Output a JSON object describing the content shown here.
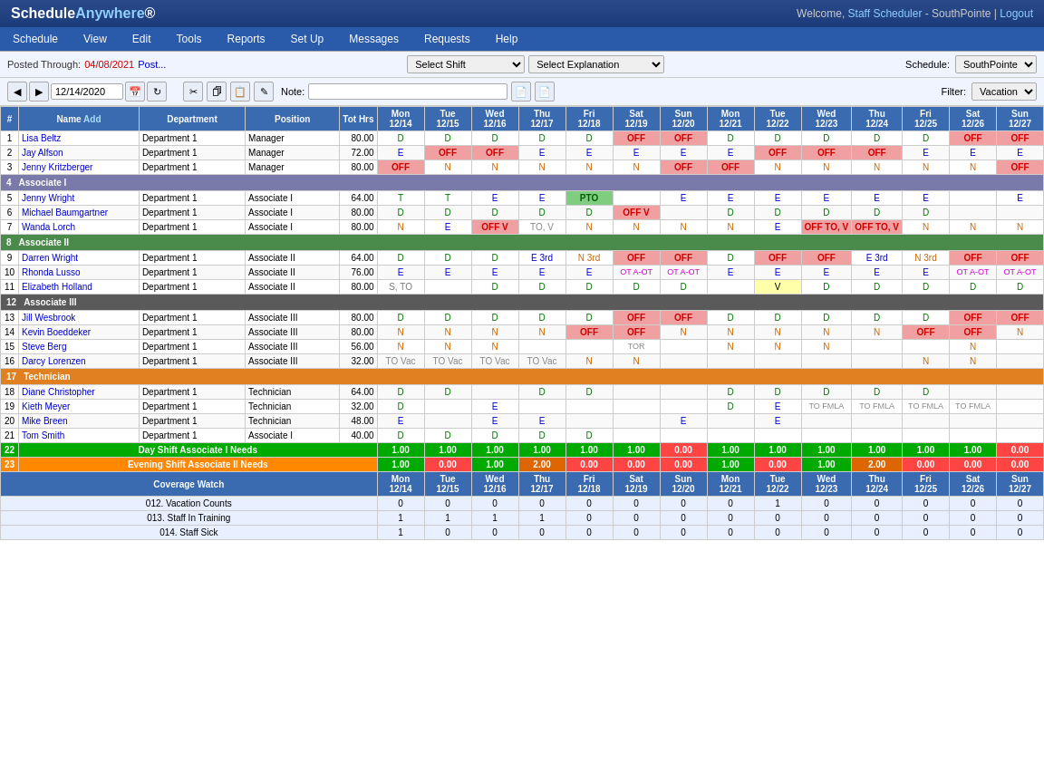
{
  "app": {
    "title": "ScheduleAnywhere",
    "welcome": "Welcome,",
    "user": "Staff Scheduler",
    "org": "SouthPointe",
    "logout": "Logout"
  },
  "nav": {
    "items": [
      "Schedule",
      "View",
      "Edit",
      "Tools",
      "Reports",
      "Set Up",
      "Messages",
      "Requests",
      "Help"
    ]
  },
  "toolbar": {
    "posted_label": "Posted Through:",
    "posted_date": "04/08/2021",
    "post_link": "Post...",
    "date_value": "12/14/2020",
    "shift_placeholder": "Select Shift",
    "explanation_placeholder": "Select Explanation",
    "note_label": "Note:",
    "schedule_label": "Schedule:",
    "schedule_value": "SouthPointe",
    "filter_label": "Filter:",
    "filter_value": "Vacation"
  },
  "table": {
    "headers": {
      "num": "#",
      "name": "Name",
      "add": "Add",
      "department": "Department",
      "position": "Position",
      "tot_hrs": "Tot Hrs",
      "days": [
        {
          "day": "Mon",
          "date": "12/14"
        },
        {
          "day": "Tue",
          "date": "12/15"
        },
        {
          "day": "Wed",
          "date": "12/16"
        },
        {
          "day": "Thu",
          "date": "12/17"
        },
        {
          "day": "Fri",
          "date": "12/18"
        },
        {
          "day": "Sat",
          "date": "12/19"
        },
        {
          "day": "Sun",
          "date": "12/20"
        },
        {
          "day": "Mon",
          "date": "12/21"
        },
        {
          "day": "Tue",
          "date": "12/22"
        },
        {
          "day": "Wed",
          "date": "12/23"
        },
        {
          "day": "Thu",
          "date": "12/24"
        },
        {
          "day": "Fri",
          "date": "12/25"
        },
        {
          "day": "Sat",
          "date": "12/26"
        },
        {
          "day": "Sun",
          "date": "12/27"
        }
      ]
    },
    "rows": [
      {
        "num": 1,
        "name": "Lisa Beltz",
        "dept": "Department 1",
        "pos": "Manager",
        "hrs": "80.00",
        "days": [
          "D",
          "D",
          "D",
          "D",
          "D",
          "OFF",
          "OFF",
          "D",
          "D",
          "D",
          "D",
          "D",
          "OFF",
          "OFF"
        ],
        "types": [
          "d",
          "d",
          "d",
          "d",
          "d",
          "off",
          "off",
          "d",
          "d",
          "d",
          "d",
          "d",
          "off",
          "off"
        ]
      },
      {
        "num": 2,
        "name": "Jay Alfson",
        "dept": "Department 1",
        "pos": "Manager",
        "hrs": "72.00",
        "days": [
          "E",
          "OFF",
          "OFF",
          "E",
          "E",
          "E",
          "E",
          "E",
          "OFF",
          "OFF",
          "OFF",
          "E",
          "E",
          "E"
        ],
        "types": [
          "e",
          "off",
          "off",
          "e",
          "e",
          "e",
          "e",
          "e",
          "off",
          "off",
          "off",
          "e",
          "e",
          "e"
        ]
      },
      {
        "num": 3,
        "name": "Jenny Kritzberger",
        "dept": "Department 1",
        "pos": "Manager",
        "hrs": "80.00",
        "days": [
          "OFF",
          "N",
          "N",
          "N",
          "N",
          "N",
          "OFF",
          "OFF",
          "N",
          "N",
          "N",
          "N",
          "N",
          "OFF"
        ],
        "types": [
          "off",
          "n",
          "n",
          "n",
          "n",
          "n",
          "off",
          "off",
          "n",
          "n",
          "n",
          "n",
          "n",
          "off"
        ]
      },
      {
        "group": true,
        "num": 4,
        "label": "Associate I",
        "class": "associate-i"
      },
      {
        "num": 5,
        "name": "Jenny Wright",
        "dept": "Department 1",
        "pos": "Associate I",
        "hrs": "64.00",
        "days": [
          "T",
          "T",
          "E",
          "E",
          "PTO",
          "",
          "E",
          "E",
          "E",
          "E",
          "E",
          "E",
          "",
          "E"
        ],
        "types": [
          "t",
          "t",
          "e",
          "e",
          "pto",
          "",
          "e",
          "e",
          "e",
          "e",
          "e",
          "e",
          "",
          "e"
        ]
      },
      {
        "num": 6,
        "name": "Michael Baumgartner",
        "dept": "Department 1",
        "pos": "Associate I",
        "hrs": "80.00",
        "days": [
          "D",
          "D",
          "D",
          "D",
          "D",
          "OFF V",
          "",
          "D",
          "D",
          "D",
          "D",
          "D",
          "",
          ""
        ],
        "types": [
          "d",
          "d",
          "d",
          "d",
          "d",
          "off-v",
          "",
          "d",
          "d",
          "d",
          "d",
          "d",
          "",
          ""
        ]
      },
      {
        "num": 7,
        "name": "Wanda Lorch",
        "dept": "Department 1",
        "pos": "Associate I",
        "hrs": "80.00",
        "days": [
          "N",
          "E",
          "OFF V",
          "TO, V",
          "N",
          "N",
          "N",
          "N",
          "E",
          "OFF TO, V",
          "OFF TO, V",
          "N",
          "N",
          "N"
        ],
        "types": [
          "n",
          "e",
          "off-v",
          "to-v",
          "n",
          "n",
          "n",
          "n",
          "e",
          "off-to-v",
          "off-to-v",
          "n",
          "n",
          "n"
        ]
      },
      {
        "group": true,
        "num": 8,
        "label": "Associate II",
        "class": "associate-ii"
      },
      {
        "num": 9,
        "name": "Darren Wright",
        "dept": "Department 1",
        "pos": "Associate II",
        "hrs": "64.00",
        "days": [
          "D",
          "D",
          "D",
          "E 3rd",
          "N 3rd",
          "OFF",
          "OFF",
          "D",
          "OFF",
          "OFF",
          "E 3rd",
          "N 3rd",
          "OFF",
          "OFF"
        ],
        "types": [
          "d",
          "d",
          "d",
          "e",
          "n",
          "off",
          "off",
          "d",
          "off",
          "off",
          "e",
          "n",
          "off",
          "off"
        ]
      },
      {
        "num": 10,
        "name": "Rhonda Lusso",
        "dept": "Department 1",
        "pos": "Associate II",
        "hrs": "76.00",
        "days": [
          "E",
          "E",
          "E",
          "E",
          "E",
          "OT A-OT",
          "OT A-OT",
          "E",
          "E",
          "E",
          "E",
          "E",
          "OT A-OT",
          "OT A-OT"
        ],
        "types": [
          "e",
          "e",
          "e",
          "e",
          "e",
          "ot",
          "ot",
          "e",
          "e",
          "e",
          "e",
          "e",
          "ot",
          "ot"
        ]
      },
      {
        "num": 11,
        "name": "Elizabeth Holland",
        "dept": "Department 1",
        "pos": "Associate II",
        "hrs": "80.00",
        "days": [
          "S, TO",
          "",
          "D",
          "D",
          "D",
          "D",
          "D",
          "",
          "V",
          "D",
          "D",
          "D",
          "D",
          "D"
        ],
        "types": [
          "s",
          "",
          "d",
          "d",
          "d",
          "d",
          "d",
          "",
          "v",
          "d",
          "d",
          "d",
          "d",
          "d"
        ]
      },
      {
        "group": true,
        "num": 12,
        "label": "Associate III",
        "class": "associate-iii"
      },
      {
        "num": 13,
        "name": "Jill Wesbrook",
        "dept": "Department 1",
        "pos": "Associate III",
        "hrs": "80.00",
        "days": [
          "D",
          "D",
          "D",
          "D",
          "D",
          "OFF",
          "OFF",
          "D",
          "D",
          "D",
          "D",
          "D",
          "OFF",
          "OFF"
        ],
        "types": [
          "d",
          "d",
          "d",
          "d",
          "d",
          "off",
          "off",
          "d",
          "d",
          "d",
          "d",
          "d",
          "off",
          "off"
        ]
      },
      {
        "num": 14,
        "name": "Kevin Boeddeker",
        "dept": "Department 1",
        "pos": "Associate III",
        "hrs": "80.00",
        "days": [
          "N",
          "N",
          "N",
          "N",
          "OFF",
          "OFF",
          "N",
          "N",
          "N",
          "N",
          "N",
          "OFF",
          "OFF",
          "N"
        ],
        "types": [
          "n",
          "n",
          "n",
          "n",
          "off",
          "off",
          "n",
          "n",
          "n",
          "n",
          "n",
          "off",
          "off",
          "n"
        ]
      },
      {
        "num": 15,
        "name": "Steve Berg",
        "dept": "Department 1",
        "pos": "Associate III",
        "hrs": "56.00",
        "days": [
          "N",
          "N",
          "N",
          "",
          "",
          "TOR",
          "",
          "N",
          "N",
          "N",
          "",
          "",
          "N",
          ""
        ],
        "types": [
          "n",
          "n",
          "n",
          "",
          "",
          "tor",
          "",
          "n",
          "n",
          "n",
          "",
          "",
          "n",
          ""
        ]
      },
      {
        "num": 16,
        "name": "Darcy Lorenzen",
        "dept": "Department 1",
        "pos": "Associate III",
        "hrs": "32.00",
        "days": [
          "TO Vac",
          "TO Vac",
          "TO Vac",
          "TO Vac",
          "N",
          "N",
          "",
          "",
          "",
          "",
          "",
          "N",
          "N",
          ""
        ],
        "types": [
          "to",
          "to",
          "to",
          "to",
          "n",
          "n",
          "",
          "",
          "",
          "",
          "",
          "n",
          "n",
          ""
        ]
      },
      {
        "group": true,
        "num": 17,
        "label": "Technician",
        "class": "technician"
      },
      {
        "num": 18,
        "name": "Diane Christopher",
        "dept": "Department 1",
        "pos": "Technician",
        "hrs": "64.00",
        "days": [
          "D",
          "D",
          "",
          "D",
          "D",
          "",
          "",
          "D",
          "D",
          "D",
          "D",
          "D",
          "",
          ""
        ],
        "types": [
          "d",
          "d",
          "",
          "d",
          "d",
          "",
          "",
          "d",
          "d",
          "d",
          "d",
          "d",
          "",
          ""
        ]
      },
      {
        "num": 19,
        "name": "Kieth Meyer",
        "dept": "Department 1",
        "pos": "Technician",
        "hrs": "32.00",
        "days": [
          "D",
          "",
          "E",
          "",
          "",
          "",
          "",
          "D",
          "E",
          "TO FMLA",
          "TO FMLA",
          "TO FMLA",
          "TO FMLA",
          ""
        ],
        "types": [
          "d",
          "",
          "e",
          "",
          "",
          "",
          "",
          "d",
          "e",
          "fmla",
          "fmla",
          "fmla",
          "fmla",
          ""
        ]
      },
      {
        "num": 20,
        "name": "Mike Breen",
        "dept": "Department 1",
        "pos": "Technician",
        "hrs": "48.00",
        "days": [
          "E",
          "",
          "E",
          "E",
          "",
          "",
          "E",
          "",
          "E",
          "",
          "",
          "",
          "",
          ""
        ],
        "types": [
          "e",
          "",
          "e",
          "e",
          "",
          "",
          "e",
          "",
          "e",
          "",
          "",
          "",
          "",
          ""
        ]
      },
      {
        "num": 21,
        "name": "Tom Smith",
        "dept": "Department 1",
        "pos": "Associate I",
        "hrs": "40.00",
        "days": [
          "D",
          "D",
          "D",
          "D",
          "D",
          "",
          "",
          "",
          "",
          "",
          "",
          "",
          "",
          ""
        ],
        "types": [
          "d",
          "d",
          "d",
          "d",
          "d",
          "",
          "",
          "",
          "",
          "",
          "",
          "",
          "",
          ""
        ]
      }
    ],
    "day_shift_row": {
      "num": 22,
      "label": "Day Shift Associate I Needs",
      "values": [
        "1.00",
        "1.00",
        "1.00",
        "1.00",
        "1.00",
        "1.00",
        "0.00",
        "1.00",
        "1.00",
        "1.00",
        "1.00",
        "1.00",
        "1.00",
        "0.00"
      ],
      "types": [
        "g",
        "g",
        "g",
        "g",
        "g",
        "g",
        "r",
        "g",
        "g",
        "g",
        "g",
        "g",
        "g",
        "r"
      ]
    },
    "evening_shift_row": {
      "num": 23,
      "label": "Evening Shift Associate II Needs",
      "values": [
        "1.00",
        "0.00",
        "1.00",
        "2.00",
        "0.00",
        "0.00",
        "0.00",
        "1.00",
        "0.00",
        "1.00",
        "2.00",
        "0.00",
        "0.00",
        "0.00"
      ],
      "types": [
        "g",
        "r",
        "g",
        "o",
        "r",
        "r",
        "r",
        "g",
        "r",
        "g",
        "o",
        "r",
        "r",
        "r"
      ]
    },
    "coverage_watch": {
      "label": "Coverage Watch",
      "day_headers": [
        {
          "day": "Mon",
          "date": "12/14"
        },
        {
          "day": "Tue",
          "date": "12/15"
        },
        {
          "day": "Wed",
          "date": "12/16"
        },
        {
          "day": "Thu",
          "date": "12/17"
        },
        {
          "day": "Fri",
          "date": "12/18"
        },
        {
          "day": "Sat",
          "date": "12/19"
        },
        {
          "day": "Sun",
          "date": "12/20"
        },
        {
          "day": "Mon",
          "date": "12/21"
        },
        {
          "day": "Tue",
          "date": "12/22"
        },
        {
          "day": "Wed",
          "date": "12/23"
        },
        {
          "day": "Thu",
          "date": "12/24"
        },
        {
          "day": "Fri",
          "date": "12/25"
        },
        {
          "day": "Sat",
          "date": "12/26"
        },
        {
          "day": "Sun",
          "date": "12/27"
        }
      ],
      "rows": [
        {
          "label": "012. Vacation Counts",
          "values": [
            "0",
            "0",
            "0",
            "0",
            "0",
            "0",
            "0",
            "0",
            "1",
            "0",
            "0",
            "0",
            "0",
            "0"
          ]
        },
        {
          "label": "013. Staff In Training",
          "values": [
            "1",
            "1",
            "1",
            "1",
            "0",
            "0",
            "0",
            "0",
            "0",
            "0",
            "0",
            "0",
            "0",
            "0"
          ]
        },
        {
          "label": "014. Staff Sick",
          "values": [
            "1",
            "0",
            "0",
            "0",
            "0",
            "0",
            "0",
            "0",
            "0",
            "0",
            "0",
            "0",
            "0",
            "0"
          ]
        }
      ]
    }
  }
}
